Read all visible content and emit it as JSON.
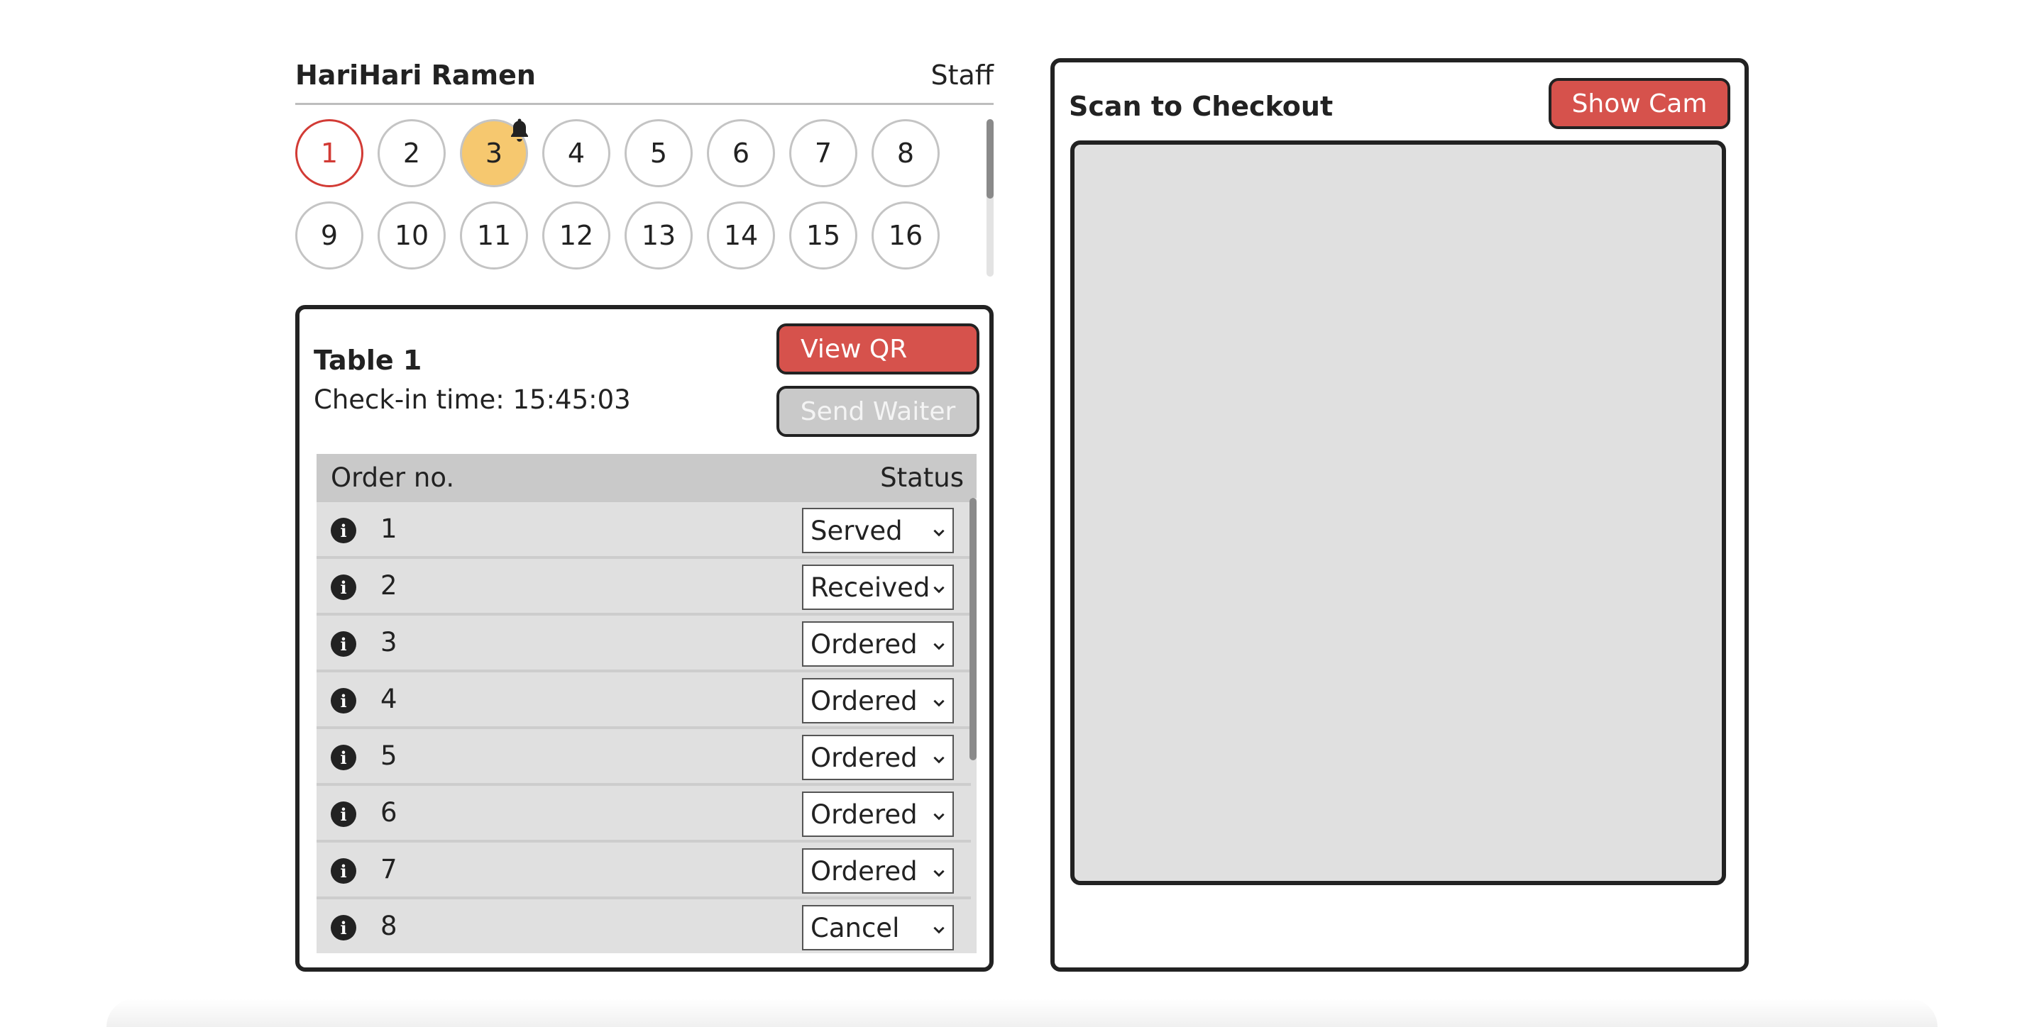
{
  "header": {
    "brand": "HariHari Ramen",
    "role": "Staff"
  },
  "tables": [
    {
      "label": "1",
      "state": "selected"
    },
    {
      "label": "2",
      "state": "default"
    },
    {
      "label": "3",
      "state": "alert",
      "bell": true
    },
    {
      "label": "4",
      "state": "default"
    },
    {
      "label": "5",
      "state": "default"
    },
    {
      "label": "6",
      "state": "default"
    },
    {
      "label": "7",
      "state": "default"
    },
    {
      "label": "8",
      "state": "default"
    },
    {
      "label": "9",
      "state": "default"
    },
    {
      "label": "10",
      "state": "default"
    },
    {
      "label": "11",
      "state": "default"
    },
    {
      "label": "12",
      "state": "default"
    },
    {
      "label": "13",
      "state": "default"
    },
    {
      "label": "14",
      "state": "default"
    },
    {
      "label": "15",
      "state": "default"
    },
    {
      "label": "16",
      "state": "default"
    }
  ],
  "table_panel": {
    "title": "Table 1",
    "checkin_label": "Check-in time: ",
    "checkin_time": "15:45:03",
    "view_qr_label": "View QR",
    "send_waiter_label": "Send Waiter",
    "columns": {
      "order": "Order no.",
      "status": "Status"
    },
    "orders": [
      {
        "no": "1",
        "status": "Served"
      },
      {
        "no": "2",
        "status": "Received"
      },
      {
        "no": "3",
        "status": "Ordered"
      },
      {
        "no": "4",
        "status": "Ordered"
      },
      {
        "no": "5",
        "status": "Ordered"
      },
      {
        "no": "6",
        "status": "Ordered"
      },
      {
        "no": "7",
        "status": "Ordered"
      },
      {
        "no": "8",
        "status": "Cancel"
      }
    ]
  },
  "checkout": {
    "title": "Scan to Checkout",
    "show_cam_label": "Show Cam"
  },
  "colors": {
    "accent_red": "#d6524c",
    "selected_border": "#d23b35",
    "alert_fill": "#f6c86f",
    "disabled_grey": "#c9c9c9"
  },
  "icons": [
    "bell-icon",
    "info-icon",
    "chevron-down-icon"
  ]
}
